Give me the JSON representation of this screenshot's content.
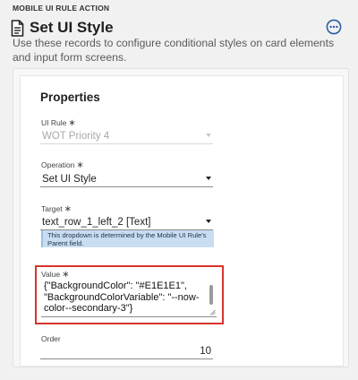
{
  "header": {
    "eyebrow": "MOBILE UI RULE ACTION",
    "title": "Set UI Style",
    "description": "Use these records to configure conditional styles on card elements and input form screens."
  },
  "properties": {
    "heading": "Properties",
    "ui_rule": {
      "label": "UI Rule",
      "required_mark": "∗",
      "value": "WOT Priority 4"
    },
    "operation": {
      "label": "Operation",
      "required_mark": "∗",
      "value": "Set UI Style"
    },
    "target": {
      "label": "Target",
      "required_mark": "∗",
      "value": "text_row_1_left_2 [Text]",
      "help": "This dropdown is determined by the Mobile UI Rule's Parent field."
    },
    "value": {
      "label": "Value",
      "required_mark": "∗",
      "text": "{\"BackgroundColor\": \"#E1E1E1\",\n\"BackgroundColorVariable\": \"--now-color--secondary-3\"}"
    },
    "order": {
      "label": "Order",
      "value": "10"
    }
  },
  "colors": {
    "highlight": "#d8332b",
    "help_bg": "#c8ddf1",
    "accent": "#2b5fa3"
  }
}
